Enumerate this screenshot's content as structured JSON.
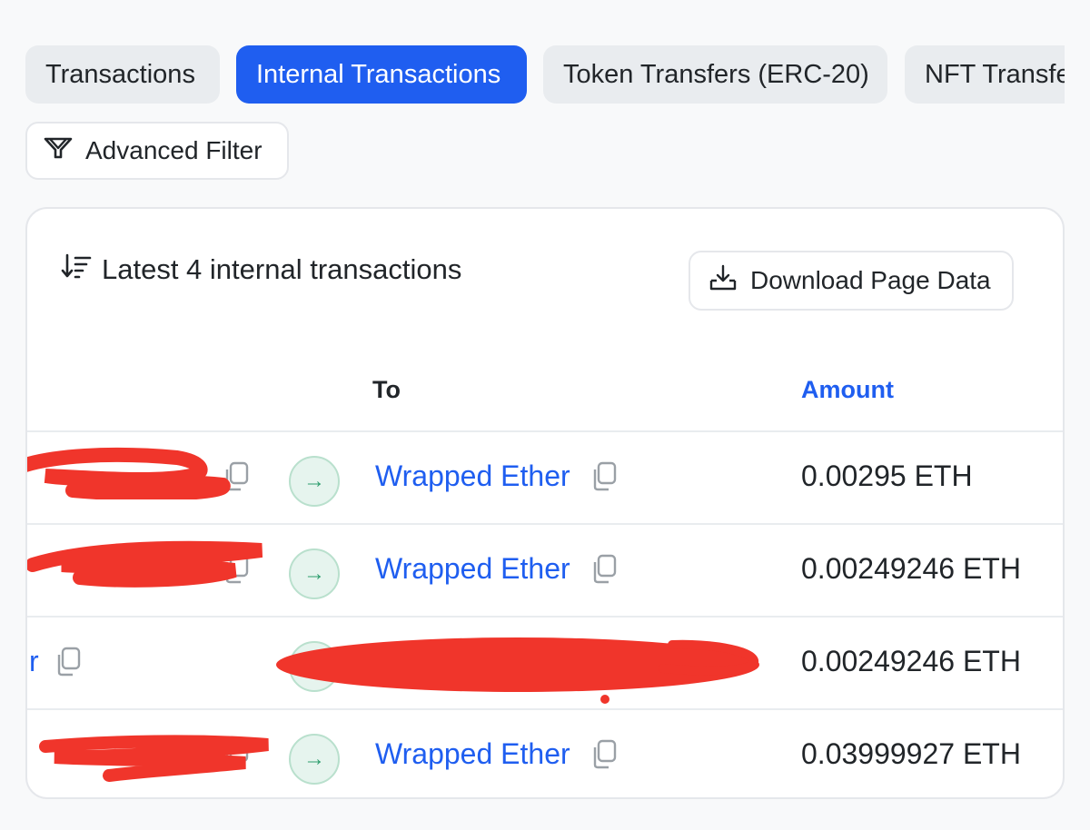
{
  "tabs": [
    {
      "label": "Transactions",
      "active": false
    },
    {
      "label": "Internal Transactions",
      "active": true
    },
    {
      "label": "Token Transfers (ERC-20)",
      "active": false
    },
    {
      "label": "NFT Transfe",
      "active": false
    }
  ],
  "filter": {
    "label": "Advanced Filter",
    "icon": "filter-icon"
  },
  "card": {
    "title": "Latest 4 internal transactions",
    "title_icon": "sort-desc-icon",
    "download_label": "Download Page Data",
    "download_icon": "download-icon"
  },
  "table": {
    "headers": {
      "to": "To",
      "amount": "Amount"
    },
    "rows": [
      {
        "to": "Wrapped Ether",
        "amount": "0.00295 ETH"
      },
      {
        "to": "Wrapped Ether",
        "amount": "0.00249246 ETH"
      },
      {
        "from_fragment": "r",
        "amount": "0.00249246 ETH"
      },
      {
        "to": "Wrapped Ether",
        "amount": "0.03999927 ETH"
      }
    ]
  },
  "colors": {
    "accent": "#1f5ef0",
    "redaction": "#f0352b",
    "arrow_bg": "#e6f4ee"
  }
}
